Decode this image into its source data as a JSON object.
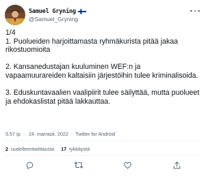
{
  "author": {
    "display_name": "Samuel Gryning",
    "handle": "@Samuel_Gryning",
    "flag_icon": "finnish-flag-icon",
    "avatar_icon": "avatar-icon"
  },
  "tweet": {
    "lines": [
      "1/4",
      "1. Puolueiden harjoittamasta ryhmäkurista pitää jakaa rikostuomioita",
      "",
      "2. Kansanedustajan kuuluminen WEF:n ja vapaamuurareiden kaltaisiin järjestöihin tulee kriminalisoida.",
      "",
      "3. Eduskuntavaalien vaalipiirit tulee säilyttää, mutta puolueet ja ehdokaslistat pitää lakkauttaa."
    ]
  },
  "meta": {
    "time": "5.57 ip.",
    "separator": "·",
    "date": "24. marrask. 2022",
    "source": "Twitter for Android"
  },
  "stats": {
    "retweets_count": "2",
    "retweets_label": "uudelleentwiittausta",
    "likes_count": "17",
    "likes_label": "tykkäystä"
  },
  "actions": [
    {
      "icon": "reply-icon"
    },
    {
      "icon": "retweet-icon"
    },
    {
      "icon": "like-icon"
    },
    {
      "icon": "share-icon"
    }
  ],
  "colors": {
    "text": "#0f1419",
    "secondary": "#536471",
    "divider": "#eff3f4",
    "flag_blue": "#003580"
  }
}
